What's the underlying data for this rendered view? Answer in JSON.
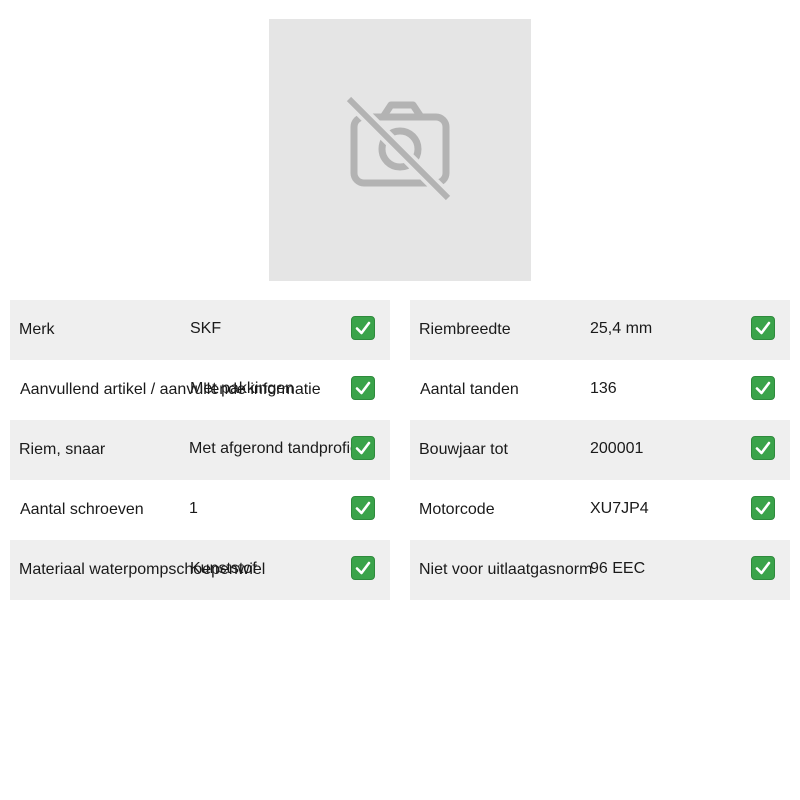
{
  "image": {
    "icon": "no-camera-icon"
  },
  "specs_left": [
    {
      "label": "Merk",
      "value": "SKF"
    },
    {
      "label": "Aanvullend artikel / aanvullende informatie",
      "value": "Met pakkingen"
    },
    {
      "label": "Riem, snaar",
      "value": "Met afgerond tandprofiel"
    },
    {
      "label": "Aantal schroeven",
      "value": "1"
    },
    {
      "label": "Materiaal waterpompschoepenwiel",
      "value": "Kunststof"
    }
  ],
  "specs_right": [
    {
      "label": "Riembreedte",
      "value": "25,4 mm"
    },
    {
      "label": "Aantal tanden",
      "value": "136"
    },
    {
      "label": "Bouwjaar tot",
      "value": "200001"
    },
    {
      "label": "Motorcode",
      "value": "XU7JP4"
    },
    {
      "label": "Niet voor uitlaatgasnorm",
      "value": "96 EEC"
    }
  ],
  "check_icon": "check-mark-icon",
  "colors": {
    "image_bg": "#e5e5e5",
    "row_shaded": "#efefef",
    "check_green": "#3aa34a"
  }
}
